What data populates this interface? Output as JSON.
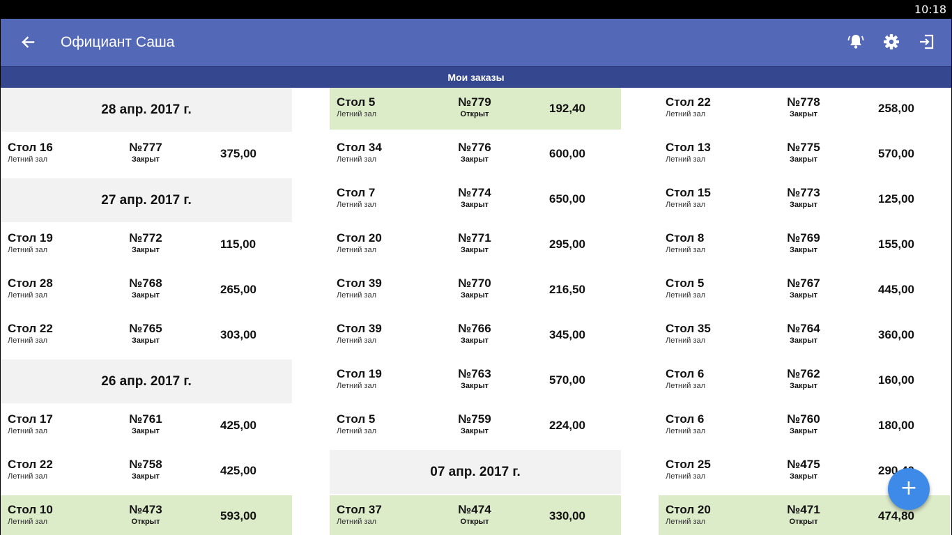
{
  "status_bar": {
    "time": "10:18"
  },
  "app_bar": {
    "title": "Официант Саша",
    "back_icon": "arrow-left-icon",
    "notifications_icon": "bell-ring-icon",
    "settings_icon": "gear-icon",
    "logout_icon": "exit-icon",
    "color": "#5468b8"
  },
  "sub_bar": {
    "title": "Мои заказы",
    "color": "#35488f"
  },
  "colors": {
    "open_order_bg": "#dcebc8",
    "date_header_bg": "#f2f2f2",
    "fab": "#3d8ae8"
  },
  "fab": {
    "label": "+",
    "icon": "plus-icon"
  },
  "columns": [
    [
      {
        "kind": "date",
        "label": "28 апр. 2017 г."
      },
      {
        "kind": "order",
        "table": "Стол 16",
        "hall": "Летний зал",
        "number": "№777",
        "status": "Закрыт",
        "sum": "375,00",
        "open": false
      },
      {
        "kind": "date",
        "label": "27 апр. 2017 г."
      },
      {
        "kind": "order",
        "table": "Стол 19",
        "hall": "Летний зал",
        "number": "№772",
        "status": "Закрыт",
        "sum": "115,00",
        "open": false
      },
      {
        "kind": "order",
        "table": "Стол 28",
        "hall": "Летний зал",
        "number": "№768",
        "status": "Закрыт",
        "sum": "265,00",
        "open": false
      },
      {
        "kind": "order",
        "table": "Стол 22",
        "hall": "Летний зал",
        "number": "№765",
        "status": "Закрыт",
        "sum": "303,00",
        "open": false
      },
      {
        "kind": "date",
        "label": "26 апр. 2017 г."
      },
      {
        "kind": "order",
        "table": "Стол 17",
        "hall": "Летний зал",
        "number": "№761",
        "status": "Закрыт",
        "sum": "425,00",
        "open": false
      },
      {
        "kind": "order",
        "table": "Стол 22",
        "hall": "Летний зал",
        "number": "№758",
        "status": "Закрыт",
        "sum": "425,00",
        "open": false
      },
      {
        "kind": "order",
        "table": "Стол 10",
        "hall": "Летний зал",
        "number": "№473",
        "status": "Открыт",
        "sum": "593,00",
        "open": true
      }
    ],
    [
      {
        "kind": "order",
        "table": "Стол 5",
        "hall": "Летний зал",
        "number": "№779",
        "status": "Открыт",
        "sum": "192,40",
        "open": true
      },
      {
        "kind": "order",
        "table": "Стол 34",
        "hall": "Летний зал",
        "number": "№776",
        "status": "Закрыт",
        "sum": "600,00",
        "open": false
      },
      {
        "kind": "order",
        "table": "Стол 7",
        "hall": "Летний зал",
        "number": "№774",
        "status": "Закрыт",
        "sum": "650,00",
        "open": false
      },
      {
        "kind": "order",
        "table": "Стол 20",
        "hall": "Летний зал",
        "number": "№771",
        "status": "Закрыт",
        "sum": "295,00",
        "open": false
      },
      {
        "kind": "order",
        "table": "Стол 39",
        "hall": "Летний зал",
        "number": "№770",
        "status": "Закрыт",
        "sum": "216,50",
        "open": false
      },
      {
        "kind": "order",
        "table": "Стол 39",
        "hall": "Летний зал",
        "number": "№766",
        "status": "Закрыт",
        "sum": "345,00",
        "open": false
      },
      {
        "kind": "order",
        "table": "Стол 19",
        "hall": "Летний зал",
        "number": "№763",
        "status": "Закрыт",
        "sum": "570,00",
        "open": false
      },
      {
        "kind": "order",
        "table": "Стол 5",
        "hall": "Летний зал",
        "number": "№759",
        "status": "Закрыт",
        "sum": "224,00",
        "open": false
      },
      {
        "kind": "date",
        "label": "07 апр. 2017 г."
      },
      {
        "kind": "order",
        "table": "Стол 37",
        "hall": "Летний зал",
        "number": "№474",
        "status": "Открыт",
        "sum": "330,00",
        "open": true
      }
    ],
    [
      {
        "kind": "order",
        "table": "Стол 22",
        "hall": "Летний зал",
        "number": "№778",
        "status": "Закрыт",
        "sum": "258,00",
        "open": false
      },
      {
        "kind": "order",
        "table": "Стол 13",
        "hall": "Летний зал",
        "number": "№775",
        "status": "Закрыт",
        "sum": "570,00",
        "open": false
      },
      {
        "kind": "order",
        "table": "Стол 15",
        "hall": "Летний зал",
        "number": "№773",
        "status": "Закрыт",
        "sum": "125,00",
        "open": false
      },
      {
        "kind": "order",
        "table": "Стол 8",
        "hall": "Летний зал",
        "number": "№769",
        "status": "Закрыт",
        "sum": "155,00",
        "open": false
      },
      {
        "kind": "order",
        "table": "Стол 5",
        "hall": "Летний зал",
        "number": "№767",
        "status": "Закрыт",
        "sum": "445,00",
        "open": false
      },
      {
        "kind": "order",
        "table": "Стол 35",
        "hall": "Летний зал",
        "number": "№764",
        "status": "Закрыт",
        "sum": "360,00",
        "open": false
      },
      {
        "kind": "order",
        "table": "Стол 6",
        "hall": "Летний зал",
        "number": "№762",
        "status": "Закрыт",
        "sum": "160,00",
        "open": false
      },
      {
        "kind": "order",
        "table": "Стол 6",
        "hall": "Летний зал",
        "number": "№760",
        "status": "Закрыт",
        "sum": "180,00",
        "open": false
      },
      {
        "kind": "order",
        "table": "Стол 25",
        "hall": "Летний зал",
        "number": "№475",
        "status": "Закрыт",
        "sum": "290,40",
        "open": false
      },
      {
        "kind": "order",
        "table": "Стол 20",
        "hall": "Летний зал",
        "number": "№471",
        "status": "Открыт",
        "sum": "474,80",
        "open": true
      }
    ]
  ]
}
